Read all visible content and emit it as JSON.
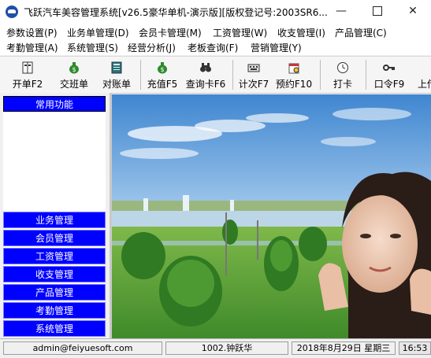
{
  "window": {
    "title": "飞跃汽车美容管理系统[v26.5豪华单机-演示版][版权登记号:2003SR6..."
  },
  "menu": {
    "row1": [
      "参数设置(P)",
      "业务单管理(D)",
      "会员卡管理(M)",
      "工资管理(W)",
      "收支管理(I)",
      "产品管理(C)"
    ],
    "row2": [
      "考勤管理(A)",
      "系统管理(S)",
      "经营分析(J)",
      "老板查询(F)",
      "营销管理(Y)"
    ]
  },
  "toolbar": {
    "buttons": [
      {
        "label": "开单F2",
        "icon": "cash-register-icon"
      },
      {
        "label": "交班单",
        "icon": "money-bag-icon"
      },
      {
        "label": "对账单",
        "icon": "ledger-icon"
      },
      {
        "label": "充值F5",
        "icon": "money-bag-icon"
      },
      {
        "label": "查询卡F6",
        "icon": "binoculars-icon"
      },
      {
        "label": "计次F7",
        "icon": "keyboard-icon"
      },
      {
        "label": "预约F10",
        "icon": "calendar-icon"
      },
      {
        "label": "打卡",
        "icon": "clock-icon"
      },
      {
        "label": "口令F9",
        "icon": "key-icon"
      },
      {
        "label": "上传",
        "icon": "upload-icon"
      }
    ]
  },
  "sidebar": {
    "header": "常用功能",
    "items": [
      "业务管理",
      "会员管理",
      "工资管理",
      "收支管理",
      "产品管理",
      "考勤管理",
      "系统管理"
    ]
  },
  "status": {
    "email": "admin@feiyuesoft.com",
    "user": "1002.钟跃华",
    "date": "2018年8月29日  星期三",
    "time": "16:53"
  },
  "colors": {
    "sidebar_accent": "#0000ff",
    "sky": "#5b9bd8",
    "grass": "#5aa53a"
  }
}
